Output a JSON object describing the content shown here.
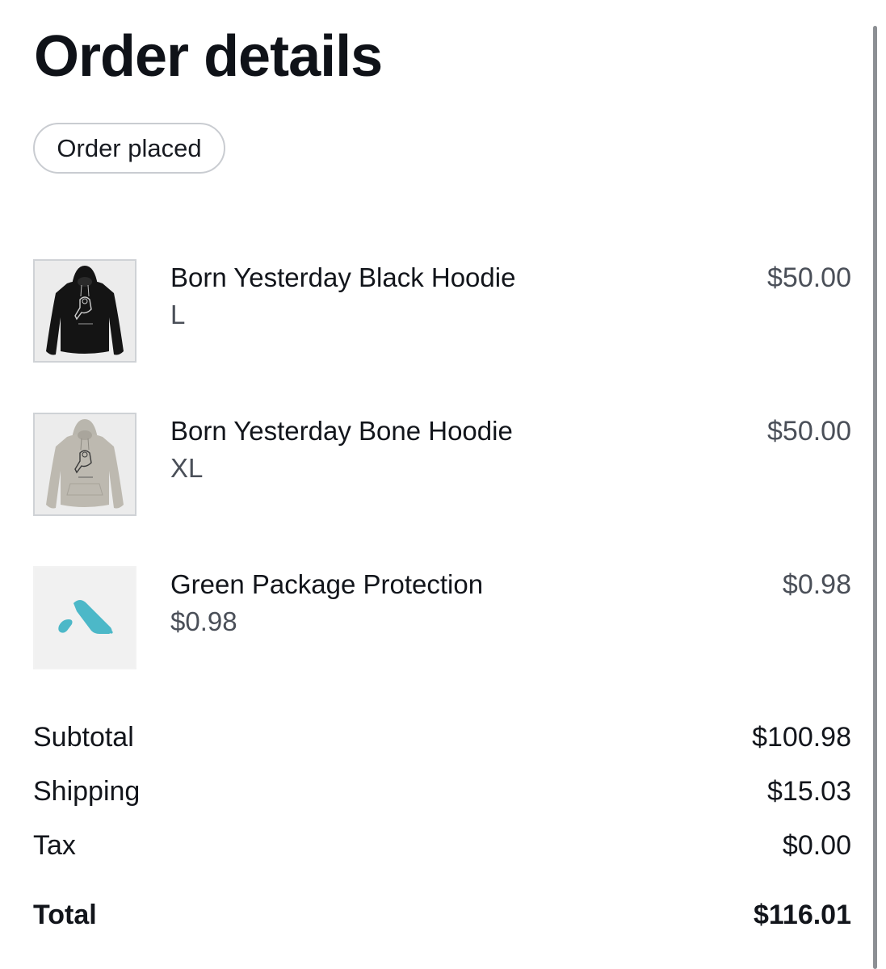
{
  "page": {
    "title": "Order details",
    "status": "Order placed"
  },
  "items": [
    {
      "name": "Born Yesterday Black Hoodie",
      "variant": "L",
      "price": "$50.00",
      "image": "black-hoodie-image"
    },
    {
      "name": "Born Yesterday Bone Hoodie",
      "variant": "XL",
      "price": "$50.00",
      "image": "bone-hoodie-image"
    },
    {
      "name": "Green Package Protection",
      "variant": "$0.98",
      "price": "$0.98",
      "image": "package-protection-logo"
    }
  ],
  "summary": {
    "subtotal_label": "Subtotal",
    "subtotal": "$100.98",
    "shipping_label": "Shipping",
    "shipping": "$15.03",
    "tax_label": "Tax",
    "tax": "$0.00",
    "total_label": "Total",
    "total": "$116.01"
  },
  "colors": {
    "text": "#0f1218",
    "muted": "#4a4f58",
    "border": "#c9ccd1",
    "logo": "#4cb8c8"
  }
}
